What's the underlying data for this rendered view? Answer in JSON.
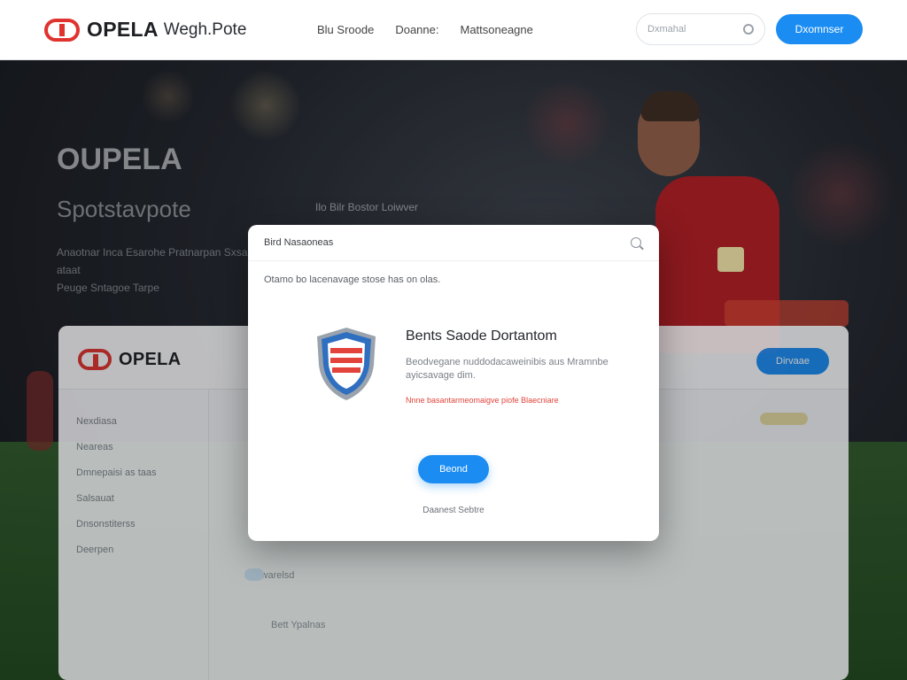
{
  "header": {
    "logo_text": "OPELA",
    "logo_sub": "Wegh.Pote",
    "nav": [
      "Blu Sroode",
      "Doanne:",
      "Mattsoneagne"
    ],
    "search_placeholder": "Dxmahal",
    "cta_label": "Dxomnser"
  },
  "hero": {
    "title": "OUPELA",
    "subtitle": "Spotstavpote",
    "inline_text": "Ilo Bilr Bostor Loiwver",
    "description": "Anaotnar Inca Esarohe Pratnarpan Sxsa ataat",
    "description2": "Peuge Sntagoe Tarpe"
  },
  "background_window": {
    "logo_text": "OPELA",
    "button_label": "Dirvaae",
    "sidebar_items": [
      "Nexdiasa",
      "Neareas",
      "Dmnepaisi as taas",
      "Salsauat",
      "Dnsonstiterss",
      "Deerpen"
    ],
    "rows": [
      "Stawarelsd",
      "Bett Ypalnas"
    ]
  },
  "modal": {
    "title": "Bird Nasaoneas",
    "notice": "Otamo bo lacenavage stose has on olas.",
    "info_title": "Bents Saode Dortantom",
    "info_desc": "Beodvegane nuddodacaweinibis aus Mramnbe ayicsavage dim.",
    "info_warn": "Nnne basantarmeomaigve piofe Blaecniare",
    "button_label": "Beond",
    "link_label": "Daanest Sebtre"
  },
  "colors": {
    "brand_red": "#e0332e",
    "accent_blue": "#1a8cf2",
    "warn_red": "#e0453a"
  }
}
